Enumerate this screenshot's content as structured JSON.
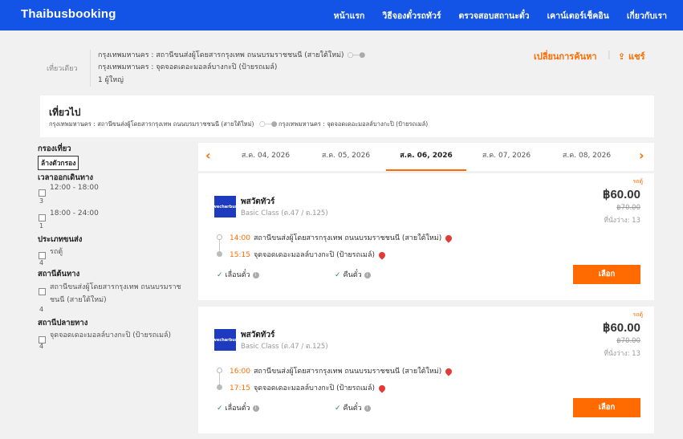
{
  "nav": {
    "brand": "Thaibusbooking",
    "links": [
      "หน้าแรก",
      "วิธีจองตั๋วรถทัวร์",
      "ตรวจสอบสถานะตั๋ว",
      "เคาน์เตอร์เช็คอิน",
      "เกี่ยวกับเรา"
    ]
  },
  "summary": {
    "trip_type": "เที่ยวเดียว",
    "origin": "กรุงเทพมหานคร : สถานีขนส่งผู้โดยสารกรุงเทพ ถนนบรมราชชนนี (สายใต้ใหม่)",
    "destination": "กรุงเทพมหานคร : จุดจอดเดอะมอลล์บางกะปิ (ป้ายรถเมล์)",
    "passengers": "1 ผู้ใหญ่",
    "change_search": "เปลี่ยนการค้นหา",
    "share": "⇪ แชร์"
  },
  "outbound": {
    "title": "เที่ยวไป",
    "origin": "กรุงเทพมหานคร : สถานีขนส่งผู้โดยสารกรุงเทพ ถนนบรมราชชนนี (สายใต้ใหม่)",
    "destination": "กรุงเทพมหานคร : จุดจอดเดอะมอลล์บางกะปิ (ป้ายรถเมล์)"
  },
  "filters": {
    "title": "กรองเที่ยว",
    "clear": "ล้างตัวกรอง",
    "departure_time": {
      "label": "เวลาออกเดินทาง",
      "options": [
        {
          "label": "12:00 - 18:00",
          "count": "3"
        },
        {
          "label": "18:00 - 24:00",
          "count": "1"
        }
      ]
    },
    "vehicle_type": {
      "label": "ประเภทขนส่ง",
      "options": [
        {
          "label": "รถตู้",
          "count": "4"
        }
      ]
    },
    "origin_station": {
      "label": "สถานีต้นทาง",
      "options": [
        {
          "label_line1": "สถานีขนส่งผู้โดยสารกรุงเทพ ถนนบรมราช",
          "label_line2": "ชนนี (สายใต้ใหม่)",
          "count": "4"
        }
      ]
    },
    "destination_station": {
      "label": "สถานีปลายทาง",
      "options": [
        {
          "label": "จุดจอดเดอะมอลล์บางกะปิ (ป้ายรถเมล์)",
          "count": "4"
        }
      ]
    }
  },
  "dates": {
    "prev_icon": "chevron-left",
    "next_icon": "chevron-right",
    "tabs": [
      "ส.ค. 04, 2026",
      "ส.ค. 05, 2026",
      "ส.ค. 06, 2026",
      "ส.ค. 07, 2026",
      "ส.ค. 08, 2026"
    ],
    "active_index": 2
  },
  "trips": [
    {
      "tag": "รถตู้",
      "logo_text": "wecharbus",
      "operator": "พสวัตทัวร์",
      "bus_class": "Basic Class (ต.47 / ต.125)",
      "price": "฿60.00",
      "old_price": "฿70.00",
      "seats": "ที่นั่งว่าง: 13",
      "depart_time": "14:00",
      "depart_station": "สถานีขนส่งผู้โดยสารกรุงเทพ ถนนบรมราชชนนี (สายใต้ใหม่)",
      "arrive_time": "15:15",
      "arrive_station": "จุดจอดเดอะมอลล์บางกะปิ (ป้ายรถเมล์)",
      "feature1": "เลื่อนตั๋ว",
      "feature2": "คืนตั๋ว",
      "select": "เลือก"
    },
    {
      "tag": "รถตู้",
      "logo_text": "wecharbus",
      "operator": "พสวัตทัวร์",
      "bus_class": "Basic Class (ต.47 / ต.125)",
      "price": "฿60.00",
      "old_price": "฿70.00",
      "seats": "ที่นั่งว่าง: 13",
      "depart_time": "16:00",
      "depart_station": "สถานีขนส่งผู้โดยสารกรุงเทพ ถนนบรมราชชนนี (สายใต้ใหม่)",
      "arrive_time": "17:15",
      "arrive_station": "จุดจอดเดอะมอลล์บางกะปิ (ป้ายรถเมล์)",
      "feature1": "เลื่อนตั๋ว",
      "feature2": "คืนตั๋ว",
      "select": "เลือก"
    }
  ],
  "colors": {
    "nav_bg": "#1353e6",
    "accent": "#ff6b00",
    "check": "#2e8b3a",
    "pin": "#e53935"
  }
}
